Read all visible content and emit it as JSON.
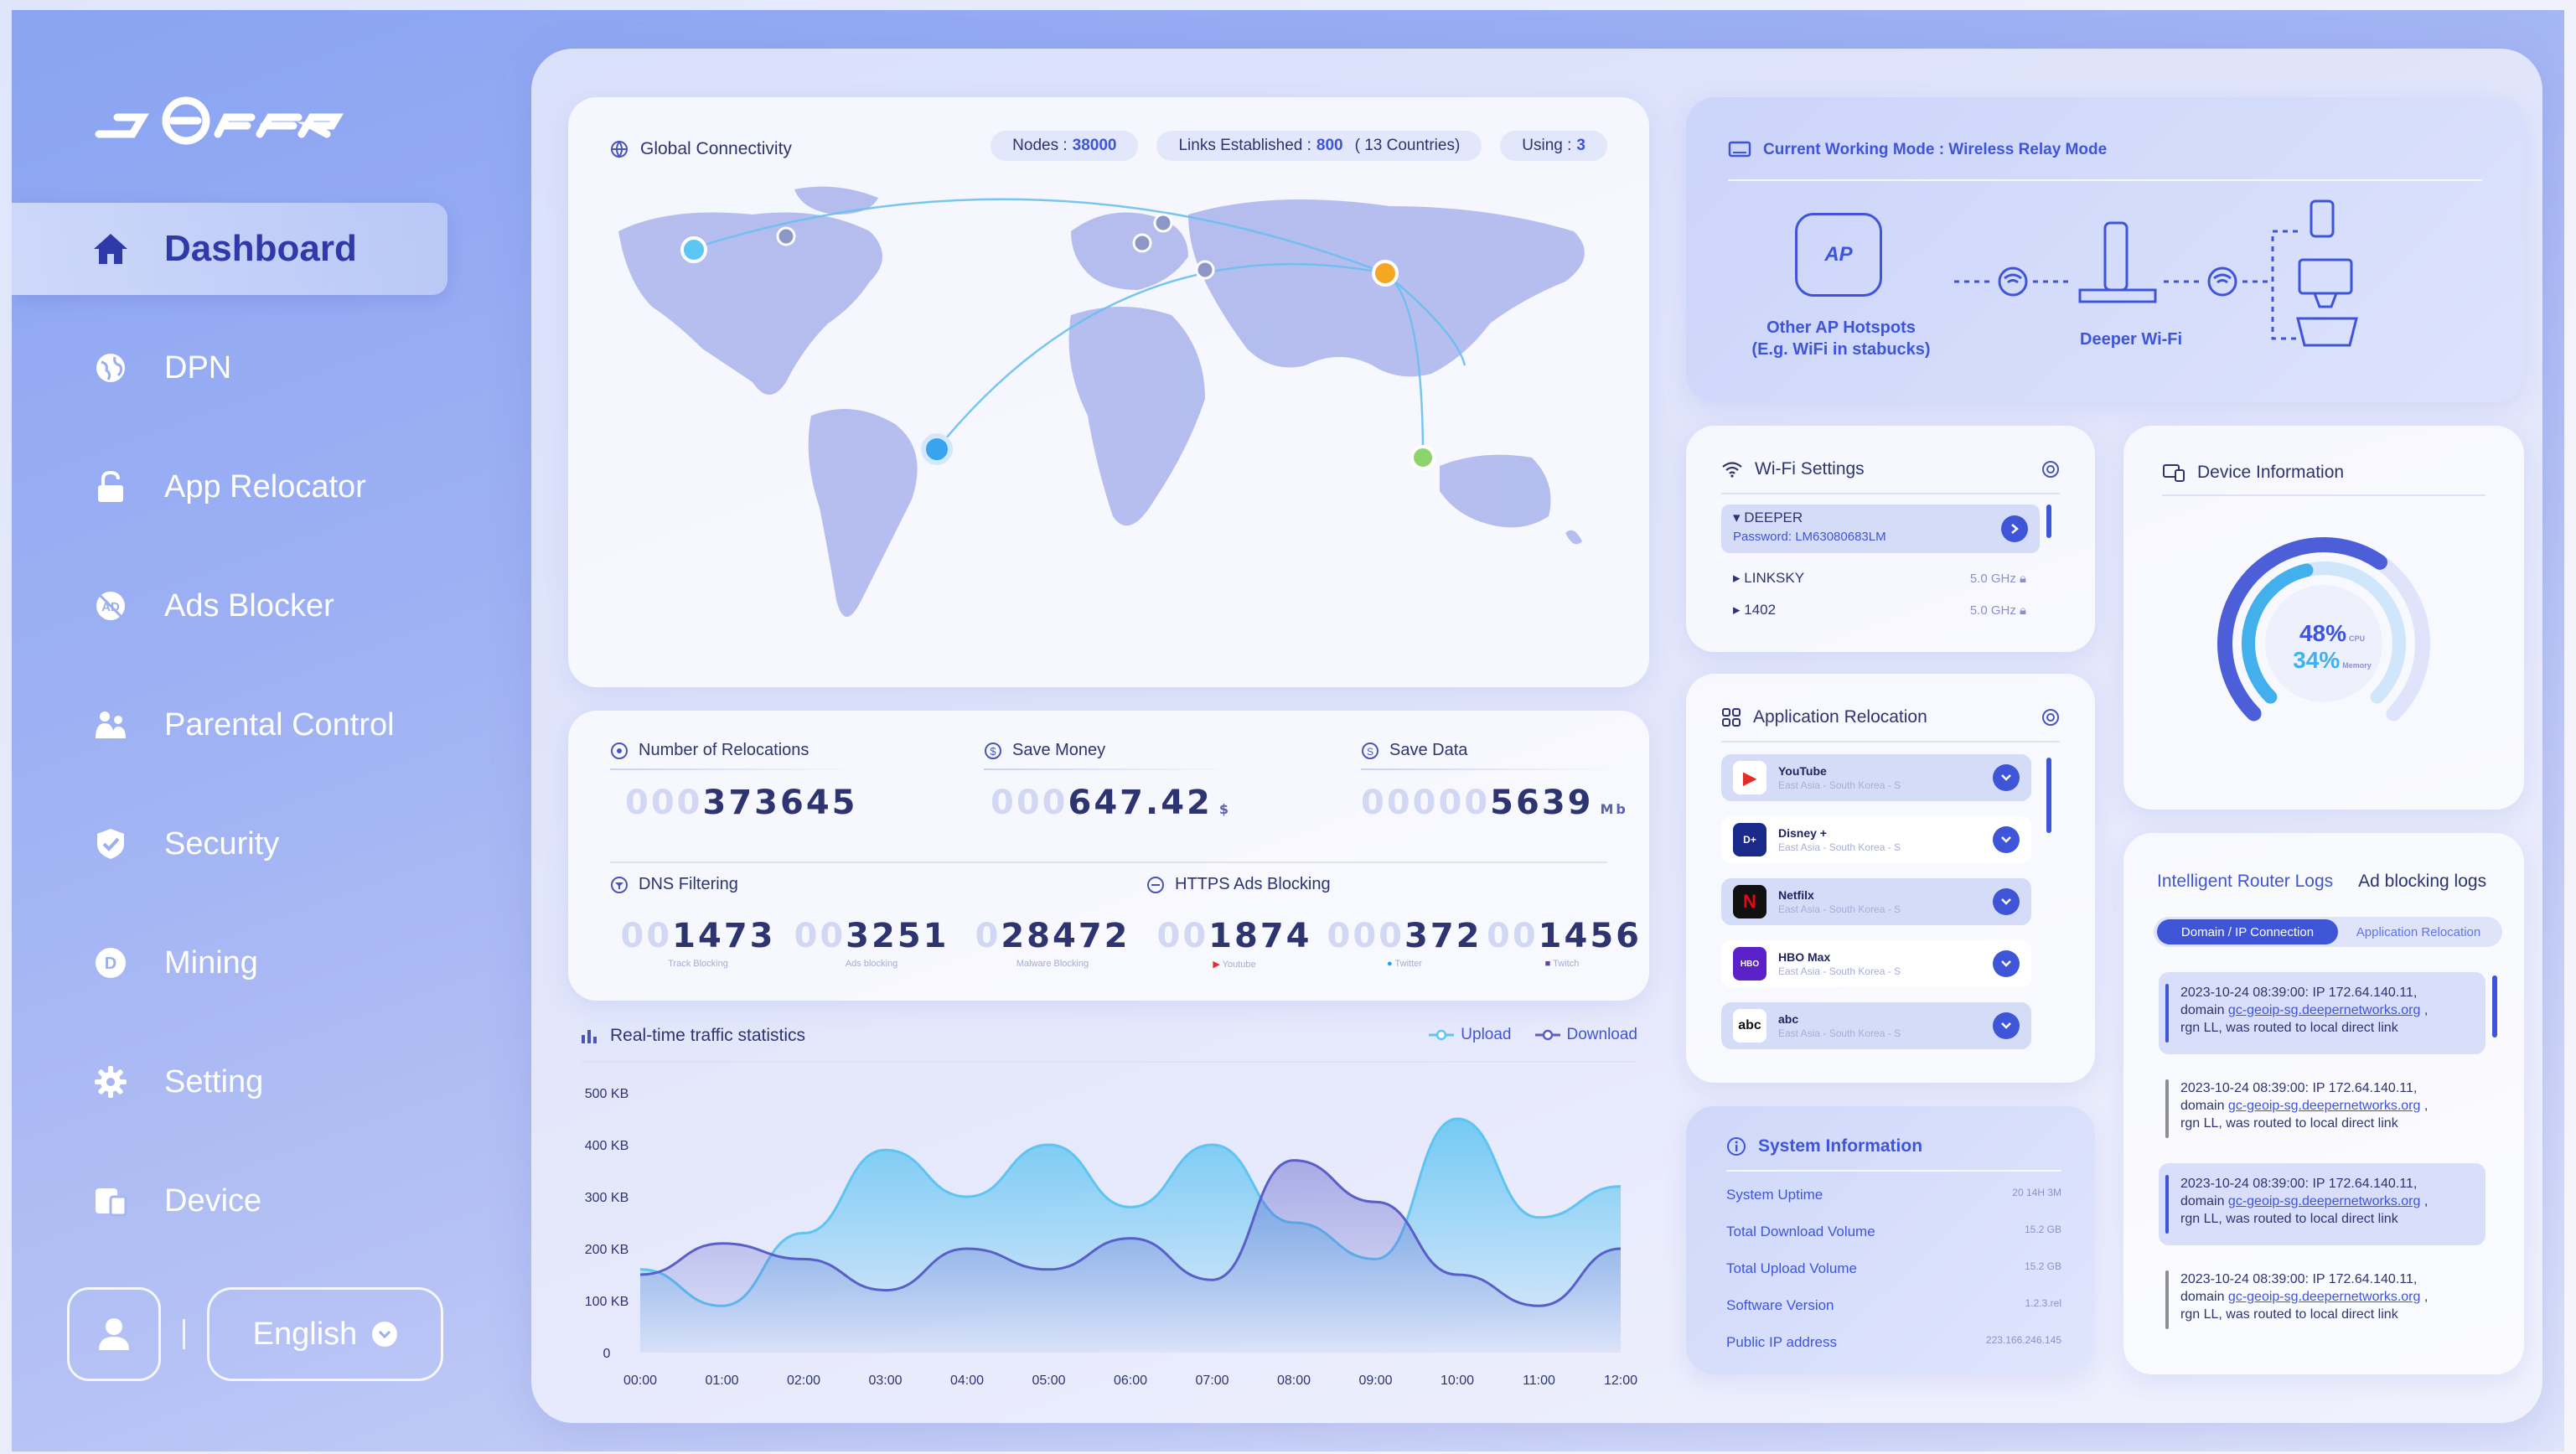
{
  "brand": {
    "logo_text": "DEEPER"
  },
  "sidebar": {
    "items": [
      {
        "label": "Dashboard",
        "icon": "home-icon",
        "active": true
      },
      {
        "label": "DPN",
        "icon": "globe-icon"
      },
      {
        "label": "App Relocator",
        "icon": "lock-icon"
      },
      {
        "label": "Ads Blocker",
        "icon": "ad-block-icon"
      },
      {
        "label": "Parental Control",
        "icon": "family-icon"
      },
      {
        "label": "Security",
        "icon": "shield-icon"
      },
      {
        "label": "Mining",
        "icon": "coin-icon"
      },
      {
        "label": "Setting",
        "icon": "gear-icon"
      },
      {
        "label": "Device",
        "icon": "device-icon"
      }
    ],
    "language": "English"
  },
  "global": {
    "title": "Global Connectivity",
    "nodes_label": "Nodes :",
    "nodes_value": "38000",
    "links_label": "Links Established :",
    "links_value": "800",
    "links_countries": "( 13 Countries)",
    "using_label": "Using :",
    "using_value": "3"
  },
  "stats": {
    "relocations": {
      "label": "Number of Relocations",
      "ghost": "000",
      "value": "373645"
    },
    "money": {
      "label": "Save Money",
      "ghost": "000",
      "value": "647.42",
      "unit": "$"
    },
    "data": {
      "label": "Save Data",
      "ghost": "00000",
      "value": "5639",
      "unit": "Mb"
    },
    "dns": {
      "label": "DNS Filtering",
      "items": [
        {
          "ghost": "00",
          "value": "1473",
          "caption": "Track Blocking"
        },
        {
          "ghost": "00",
          "value": "3251",
          "caption": "Ads blocking"
        },
        {
          "ghost": "0",
          "value": "28472",
          "caption": "Malware Blocking"
        }
      ]
    },
    "https": {
      "label": "HTTPS Ads Blocking",
      "items": [
        {
          "ghost": "00",
          "value": "1874",
          "caption": "Youtube"
        },
        {
          "ghost": "000",
          "value": "372",
          "caption": "Twitter"
        },
        {
          "ghost": "00",
          "value": "1456",
          "caption": "Twitch"
        }
      ]
    }
  },
  "traffic": {
    "title": "Real-time traffic statistics",
    "legend_upload": "Upload",
    "legend_download": "Download"
  },
  "chart_data": {
    "type": "area",
    "title": "Real-time traffic statistics",
    "x": [
      "00:00",
      "01:00",
      "02:00",
      "03:00",
      "04:00",
      "05:00",
      "06:00",
      "07:00",
      "08:00",
      "09:00",
      "10:00",
      "11:00",
      "12:00"
    ],
    "y_ticks": [
      "0",
      "100 KB",
      "200 KB",
      "300 KB",
      "400 KB",
      "500 KB"
    ],
    "ylim": [
      0,
      500
    ],
    "series": [
      {
        "name": "Upload",
        "color": "#5fc4f2",
        "values": [
          160,
          90,
          230,
          390,
          300,
          400,
          280,
          400,
          250,
          180,
          450,
          260,
          320
        ]
      },
      {
        "name": "Download",
        "color": "#5a5fc8",
        "values": [
          150,
          210,
          180,
          120,
          200,
          160,
          220,
          140,
          370,
          290,
          150,
          90,
          200
        ]
      }
    ]
  },
  "mode": {
    "title": "Current Working Mode : Wireless Relay Mode",
    "ap_label": "AP",
    "ap_caption_1": "Other AP Hotspots",
    "ap_caption_2": "(E.g. WiFi in stabucks)",
    "deeper_caption": "Deeper Wi-Fi"
  },
  "wifi": {
    "title": "Wi-Fi Settings",
    "selected_name": "▾ DEEPER",
    "selected_password": "Password: LM63080683LM",
    "networks": [
      {
        "name": "LINKSKY",
        "band": "5.0 GHz"
      },
      {
        "name": "1402",
        "band": "5.0 GHz"
      }
    ]
  },
  "device": {
    "title": "Device Information",
    "cpu_value": "48%",
    "cpu_label": "CPU",
    "cpu_pct": 48,
    "mem_value": "34%",
    "mem_label": "Memory",
    "mem_pct": 34
  },
  "relocation": {
    "title": "Application Relocation",
    "apps": [
      {
        "name": "YouTube",
        "sub": "East Asia - South Korea - S",
        "color": "#ffffff",
        "fg": "#e52d27",
        "badge": "▶"
      },
      {
        "name": "Disney +",
        "sub": "East Asia - South Korea - S",
        "color": "#1b2a8a",
        "fg": "#ffffff",
        "badge": "D+"
      },
      {
        "name": "Netfilx",
        "sub": "East Asia - South Korea - S",
        "color": "#111111",
        "fg": "#e50914",
        "badge": "N"
      },
      {
        "name": "HBO Max",
        "sub": "East Asia - South Korea - S",
        "color": "#5a22c8",
        "fg": "#ffffff",
        "badge": "HBO"
      },
      {
        "name": "abc",
        "sub": "East Asia - South Korea - S",
        "color": "#ffffff",
        "fg": "#111111",
        "badge": "abc"
      }
    ]
  },
  "system": {
    "title": "System Information",
    "rows": [
      {
        "label": "System Uptime",
        "value": "20 14H 3M"
      },
      {
        "label": "Total Download Volume",
        "value": "15.2 GB"
      },
      {
        "label": "Total Upload Volume",
        "value": "15.2 GB"
      },
      {
        "label": "Software Version",
        "value": "1.2.3.rel"
      },
      {
        "label": "Public IP address",
        "value": "223.166.246.145"
      }
    ]
  },
  "logs": {
    "tab_router": "Intelligent Router Logs",
    "tab_ads": "Ad blocking logs",
    "seg_domain": "Domain / IP Connection",
    "seg_app": "Application Relocation",
    "entries": [
      {
        "line1": "2023-10-24 08:39:00: IP 172.64.140.11,",
        "pre": "domain ",
        "link": "gc-geoip-sg.deepernetworks.org",
        "post": " ,",
        "line3": "rgn LL, was routed to local direct link"
      },
      {
        "line1": "2023-10-24 08:39:00: IP 172.64.140.11,",
        "pre": "domain ",
        "link": "gc-geoip-sg.deepernetworks.org",
        "post": " ,",
        "line3": "rgn LL, was routed to local direct link"
      },
      {
        "line1": "2023-10-24 08:39:00: IP 172.64.140.11,",
        "pre": "domain ",
        "link": "gc-geoip-sg.deepernetworks.org",
        "post": " ,",
        "line3": "rgn LL, was routed to local direct link"
      },
      {
        "line1": "2023-10-24 08:39:00: IP 172.64.140.11,",
        "pre": "domain ",
        "link": "gc-geoip-sg.deepernetworks.org",
        "post": " ,",
        "line3": "rgn LL, was routed to local direct link"
      }
    ]
  }
}
